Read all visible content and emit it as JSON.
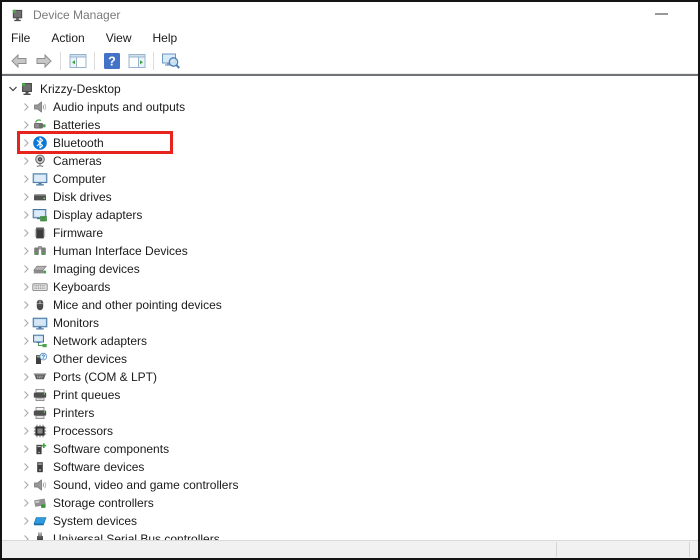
{
  "window": {
    "title": "Device Manager",
    "icon": "device-manager-icon",
    "controls": [
      {
        "name": "minimize",
        "icon": "minimize-icon"
      }
    ]
  },
  "menubar": {
    "items": [
      "File",
      "Action",
      "View",
      "Help"
    ]
  },
  "toolbar": {
    "groups": [
      [
        {
          "name": "back",
          "icon": "back-arrow-icon"
        },
        {
          "name": "forward",
          "icon": "forward-arrow-icon"
        }
      ],
      [
        {
          "name": "show-console-tree",
          "icon": "console-tree-icon"
        }
      ],
      [
        {
          "name": "help",
          "icon": "help-icon"
        },
        {
          "name": "show-action-pane",
          "icon": "action-pane-icon"
        }
      ],
      [
        {
          "name": "scan-hardware-changes",
          "icon": "scan-hardware-icon"
        }
      ]
    ]
  },
  "tree": {
    "root": {
      "label": "Krizzy-Desktop",
      "icon": "device-manager",
      "expanded": true
    },
    "items": [
      {
        "label": "Audio inputs and outputs",
        "icon": "audio"
      },
      {
        "label": "Batteries",
        "icon": "battery"
      },
      {
        "label": "Bluetooth",
        "icon": "bluetooth",
        "highlighted": true
      },
      {
        "label": "Cameras",
        "icon": "camera"
      },
      {
        "label": "Computer",
        "icon": "computer"
      },
      {
        "label": "Disk drives",
        "icon": "disk"
      },
      {
        "label": "Display adapters",
        "icon": "display"
      },
      {
        "label": "Firmware",
        "icon": "firmware"
      },
      {
        "label": "Human Interface Devices",
        "icon": "hid"
      },
      {
        "label": "Imaging devices",
        "icon": "imaging"
      },
      {
        "label": "Keyboards",
        "icon": "keyboard"
      },
      {
        "label": "Mice and other pointing devices",
        "icon": "mouse"
      },
      {
        "label": "Monitors",
        "icon": "monitor"
      },
      {
        "label": "Network adapters",
        "icon": "network"
      },
      {
        "label": "Other devices",
        "icon": "other"
      },
      {
        "label": "Ports (COM & LPT)",
        "icon": "ports"
      },
      {
        "label": "Print queues",
        "icon": "printqueue"
      },
      {
        "label": "Printers",
        "icon": "printer"
      },
      {
        "label": "Processors",
        "icon": "processor"
      },
      {
        "label": "Software components",
        "icon": "software-component"
      },
      {
        "label": "Software devices",
        "icon": "software-device"
      },
      {
        "label": "Sound, video and game controllers",
        "icon": "sound"
      },
      {
        "label": "Storage controllers",
        "icon": "storage"
      },
      {
        "label": "System devices",
        "icon": "system"
      },
      {
        "label": "Universal Serial Bus controllers",
        "icon": "usb"
      }
    ]
  },
  "annotation": {
    "highlight_color": "#e6231d",
    "highlighted_item": "Bluetooth"
  },
  "statusbar": {
    "panes": [
      "",
      "",
      ""
    ]
  }
}
